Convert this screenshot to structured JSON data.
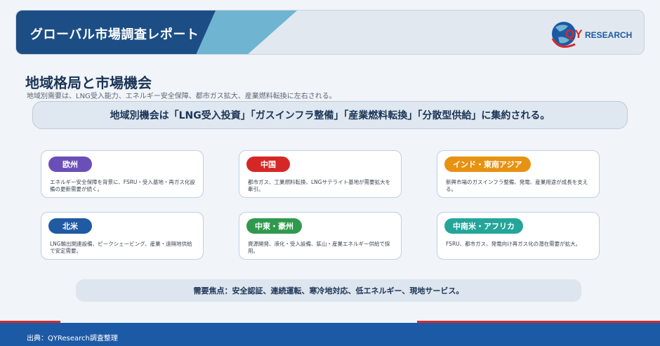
{
  "header": {
    "title": "グローバル市場調査レポート",
    "logo_text_q": "QY",
    "logo_text_rest": "RESEARCH"
  },
  "section": {
    "title": "地域格局と市場機会",
    "subtitle": "地域別需要は、LNG受入能力、エネルギー安全保障、都市ガス拡大、産業燃料転換に左右される。"
  },
  "banner": {
    "text": "地域別機会は「LNG受入投資」「ガスインフラ整備」「産業燃料転換」「分散型供給」に集約される。"
  },
  "regions": [
    {
      "label": "欧州",
      "color": "#6a4fb8",
      "text": "エネルギー安全保障を背景に、FSRU・受入基地・再ガス化設備の更新需要が続く。"
    },
    {
      "label": "中国",
      "color": "#d62727",
      "text": "都市ガス、工業燃料転換、LNGサテライト基地が需要拡大を牽引。"
    },
    {
      "label": "インド・東南アジア",
      "color": "#e89212",
      "text": "新興市場のガスインフラ整備、発電、産業用途が成長を支える。"
    },
    {
      "label": "北米",
      "color": "#1f5aa3",
      "text": "LNG輸出関連設備、ピークシェービング、産業・遠隔地供給で安定需要。"
    },
    {
      "label": "中東・豪州",
      "color": "#2f9a4e",
      "text": "資源開発、液化・受入設備、鉱山・産業エネルギー供給で採用。"
    },
    {
      "label": "中南米・アフリカ",
      "color": "#25a59a",
      "text": "FSRU、都市ガス、発電向け再ガス化の潜在需要が拡大。"
    }
  ],
  "focus": {
    "text": "需要焦点：安全認証、連続運転、寒冷地対応、低エネルギー、現地サービス。"
  },
  "footer": {
    "source": "出典：QYResearch調査整理"
  }
}
